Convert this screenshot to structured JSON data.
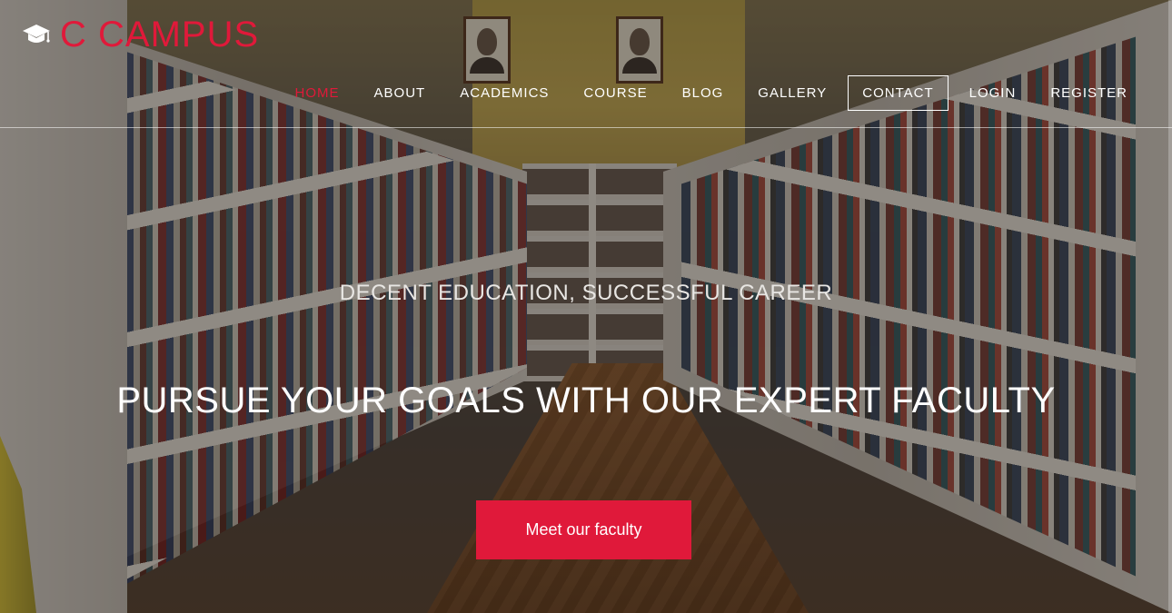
{
  "brand": {
    "name": "C CAMPUS",
    "icon": "graduation-cap-icon",
    "accent_color": "#e0193a"
  },
  "nav": {
    "items": [
      {
        "label": "HOME",
        "active": true
      },
      {
        "label": "ABOUT"
      },
      {
        "label": "ACADEMICS"
      },
      {
        "label": "COURSE"
      },
      {
        "label": "BLOG"
      },
      {
        "label": "GALLERY"
      },
      {
        "label": "CONTACT",
        "boxed": true
      },
      {
        "label": "LOGIN"
      },
      {
        "label": "REGISTER"
      }
    ]
  },
  "hero": {
    "subtitle": "DECENT EDUCATION, SUCCESSFUL CAREER",
    "headline": "PURSUE YOUR GOALS WITH OUR EXPERT FACULTY",
    "cta_label": "Meet our faculty"
  }
}
